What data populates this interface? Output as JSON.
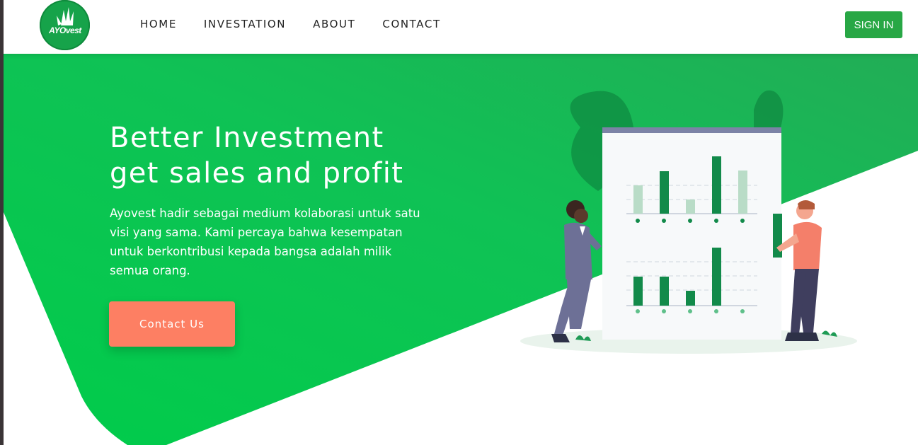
{
  "brand": {
    "logo_text": "AYOvest",
    "color": "#16a34a"
  },
  "nav": {
    "links": [
      "HOME",
      "INVESTATION",
      "ABOUT",
      "CONTACT"
    ],
    "signin_label": "SIGN IN"
  },
  "hero": {
    "title_line1": "Better Investment",
    "title_line2": "get sales and profit",
    "description": "Ayovest hadir sebagai medium kolaborasi untuk satu visi yang sama. Kami percaya bahwa kesempatan untuk berkontribusi kepada bangsa adalah milik semua orang.",
    "cta_label": "Contact Us"
  },
  "colors": {
    "hero_green": "#00c853",
    "hero_green_dark": "#1aaa55",
    "cta": "#fd7f63",
    "signin": "#28a745",
    "chart_bar": "#128a4a"
  },
  "illustration": {
    "name": "business-people-chart-illustration"
  }
}
